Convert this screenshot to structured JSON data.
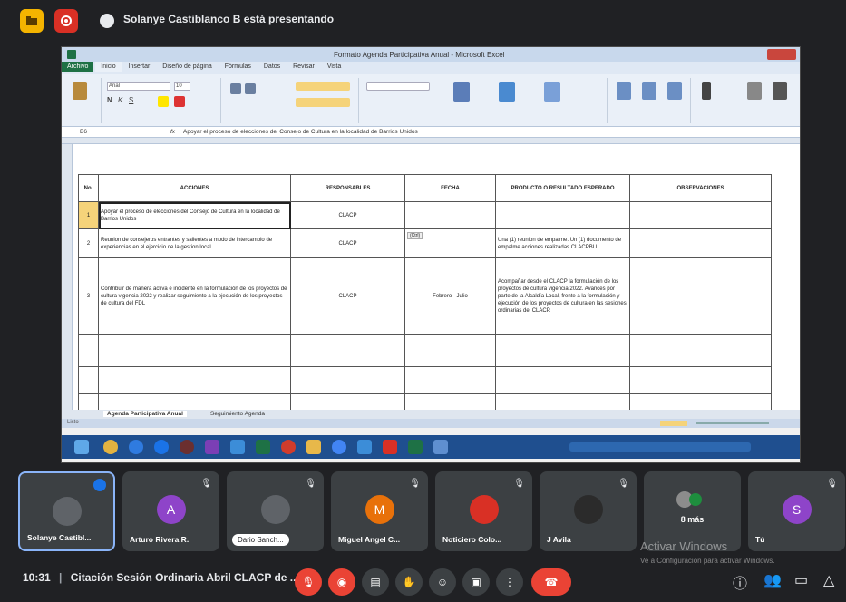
{
  "meet": {
    "presenter_text": "Solanye Castiblanco B está presentando",
    "meeting_time": "10:31",
    "meeting_title": "Citación Sesión Ordinaria Abril CLACP de ...",
    "watermark_title": "Activar Windows",
    "watermark_sub": "Ve a Configuración para activar Windows."
  },
  "excel": {
    "title": "Formato Agenda Participativa Anual - Microsoft Excel",
    "tabs": [
      "Inicio",
      "Insertar",
      "Diseño de página",
      "Fórmulas",
      "Datos",
      "Revisar",
      "Vista"
    ],
    "file_tab": "Archivo",
    "font_name": "Arial",
    "font_size": "10",
    "name_box": "B6",
    "formula": "Apoyar el proceso de elecciones del Consejo de Cultura en la localidad de Barrios Unidos",
    "headers": [
      "No.",
      "ACCIONES",
      "RESPONSABLES",
      "FECHA",
      "PRODUCTO O RESULTADO ESPERADO",
      "OBSERVACIONES"
    ],
    "rows": [
      {
        "no": "1",
        "accion": "Apoyar el proceso de elecciones del Consejo de Cultura en la localidad de Barrios Unidos",
        "resp": "CLACP",
        "fecha": "",
        "producto": "",
        "obs": ""
      },
      {
        "no": "2",
        "accion": "Reunion de consejeros entrantes y salientes a modo de intercambio de experiencias en el ejercicio de la gestion local",
        "resp": "CLACP",
        "fecha": "",
        "producto": "Una (1) reunion de empalme. Un (1) documento de empalme acciones realizadas CLACPBU",
        "obs": ""
      },
      {
        "no": "3",
        "accion": "Contribuir de manera activa e incidente en la formulación de los proyectos de cultura vigencia 2022 y realizar seguimiento a la ejecución de los proyectos de cultura del FDL",
        "resp": "CLACP",
        "fecha": "Febrero - Julio",
        "producto": "Acompañar desde el CLACP la formulación de los proyectos de cultura vigencia 2022. Avances por parte de la Alcaldía Local, frente a la formulación y ejecución de los proyectos de cultura en las sesiones ordinarias del CLACP.",
        "obs": ""
      }
    ],
    "sheet_tab": "Agenda Participativa Anual",
    "sheet_tab2": "Seguimiento Agenda",
    "status": "Listo",
    "paste_tag": "(Ctrl)"
  },
  "participants": [
    {
      "name": "Solanye Castibl...",
      "initial": "",
      "color": "#5f6368"
    },
    {
      "name": "Arturo Rivera R.",
      "initial": "A",
      "color": "#8e44c9"
    },
    {
      "name": "Dario Sanch...",
      "initial": "",
      "color": "#5f6368"
    },
    {
      "name": "Miguel Angel C...",
      "initial": "M",
      "color": "#e8710a"
    },
    {
      "name": "Noticiero Colo...",
      "initial": "",
      "color": "#d93025"
    },
    {
      "name": "J Avila",
      "initial": "",
      "color": "#3c4043"
    },
    {
      "name": "8 más",
      "initial": "",
      "color": "#3c4043"
    },
    {
      "name": "Tú",
      "initial": "S",
      "color": "#8e44c9"
    }
  ],
  "colors": {
    "end_call": "#ea4335",
    "active": "#8ab4f8"
  }
}
